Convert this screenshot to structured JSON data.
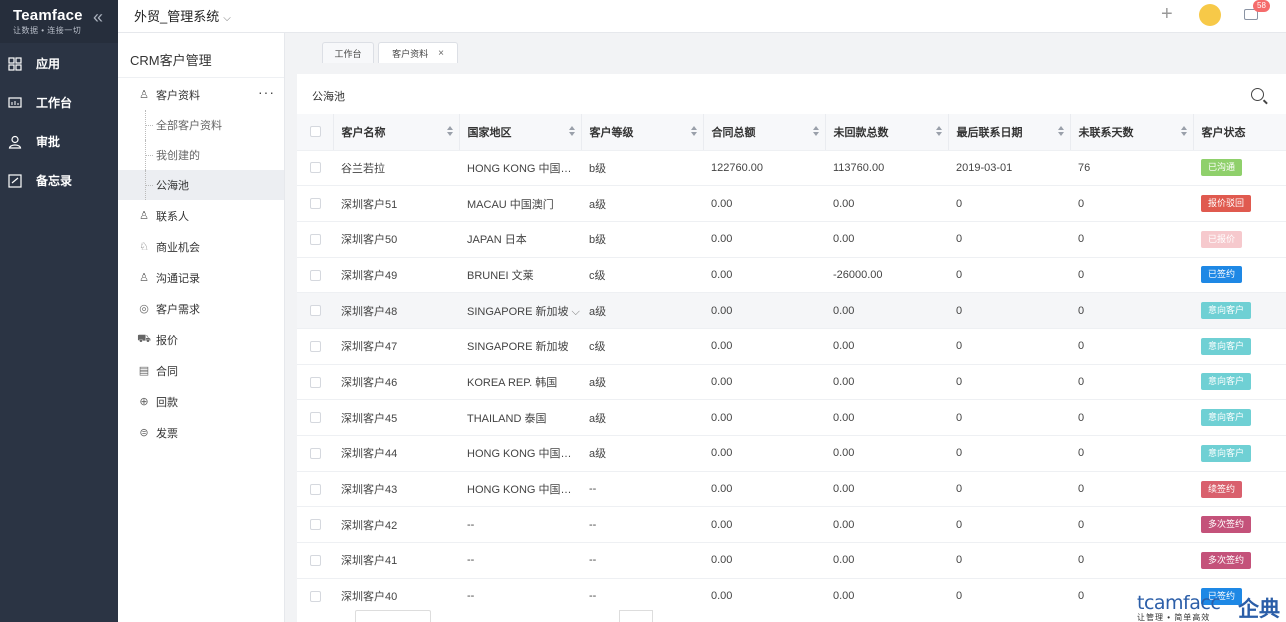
{
  "brand": {
    "name": "Teamface",
    "tagline": "让数据 • 连接一切"
  },
  "rail": [
    {
      "label": "应用",
      "icon": "grid-icon"
    },
    {
      "label": "工作台",
      "icon": "dashboard-icon"
    },
    {
      "label": "审批",
      "icon": "user-check-icon"
    },
    {
      "label": "备忘录",
      "icon": "memo-icon"
    }
  ],
  "topbar": {
    "system_title": "外贸_管理系统",
    "mail_badge": "58"
  },
  "subnav": {
    "title": "CRM客户管理",
    "customer_group": "客户资料",
    "customer_sub": [
      "全部客户资料",
      "我创建的",
      "公海池"
    ],
    "groups": [
      "联系人",
      "商业机会",
      "沟通记录",
      "客户需求",
      "报价",
      "合同",
      "回款",
      "发票"
    ]
  },
  "tabs": {
    "workbench": "工作台",
    "customer": "客户资料",
    "close": "×"
  },
  "panel": {
    "title": "公海池"
  },
  "table": {
    "headers": [
      "客户名称",
      "国家地区",
      "客户等级",
      "合同总额",
      "未回款总数",
      "最后联系日期",
      "未联系天数",
      "客户状态"
    ],
    "rows": [
      {
        "name": "谷兰若拉",
        "region": "HONG KONG 中国香港",
        "level": "b级",
        "total": "122760.00",
        "unpaid": "113760.00",
        "last_date": "2019-03-01",
        "days": "76",
        "status": "已沟通",
        "status_color": "#8fd06b"
      },
      {
        "name": "深圳客户51",
        "region": "MACAU 中国澳门",
        "level": "a级",
        "total": "0.00",
        "unpaid": "0.00",
        "last_date": "0",
        "days": "0",
        "status": "报价驳回",
        "status_color": "#e05a4f"
      },
      {
        "name": "深圳客户50",
        "region": "JAPAN 日本",
        "level": "b级",
        "total": "0.00",
        "unpaid": "0.00",
        "last_date": "0",
        "days": "0",
        "status": "已报价",
        "status_color": "#f6c9cd"
      },
      {
        "name": "深圳客户49",
        "region": "BRUNEI 文莱",
        "level": "c级",
        "total": "0.00",
        "unpaid": "-26000.00",
        "last_date": "0",
        "days": "0",
        "status": "已签约",
        "status_color": "#1e88e5"
      },
      {
        "name": "深圳客户48",
        "region": "SINGAPORE 新加坡",
        "level": "a级",
        "total": "0.00",
        "unpaid": "0.00",
        "last_date": "0",
        "days": "0",
        "status": "意向客户",
        "status_color": "#6fd0d4",
        "highlight": true
      },
      {
        "name": "深圳客户47",
        "region": "SINGAPORE 新加坡",
        "level": "c级",
        "total": "0.00",
        "unpaid": "0.00",
        "last_date": "0",
        "days": "0",
        "status": "意向客户",
        "status_color": "#6fd0d4"
      },
      {
        "name": "深圳客户46",
        "region": "KOREA REP. 韩国",
        "level": "a级",
        "total": "0.00",
        "unpaid": "0.00",
        "last_date": "0",
        "days": "0",
        "status": "意向客户",
        "status_color": "#6fd0d4"
      },
      {
        "name": "深圳客户45",
        "region": "THAILAND 泰国",
        "level": "a级",
        "total": "0.00",
        "unpaid": "0.00",
        "last_date": "0",
        "days": "0",
        "status": "意向客户",
        "status_color": "#6fd0d4"
      },
      {
        "name": "深圳客户44",
        "region": "HONG KONG 中国香港",
        "level": "a级",
        "total": "0.00",
        "unpaid": "0.00",
        "last_date": "0",
        "days": "0",
        "status": "意向客户",
        "status_color": "#6fd0d4"
      },
      {
        "name": "深圳客户43",
        "region": "HONG KONG 中国香港",
        "level": "--",
        "total": "0.00",
        "unpaid": "0.00",
        "last_date": "0",
        "days": "0",
        "status": "续签约",
        "status_color": "#d9606d"
      },
      {
        "name": "深圳客户42",
        "region": "--",
        "level": "--",
        "total": "0.00",
        "unpaid": "0.00",
        "last_date": "0",
        "days": "0",
        "status": "多次签约",
        "status_color": "#c4527a"
      },
      {
        "name": "深圳客户41",
        "region": "--",
        "level": "--",
        "total": "0.00",
        "unpaid": "0.00",
        "last_date": "0",
        "days": "0",
        "status": "多次签约",
        "status_color": "#c4527a"
      },
      {
        "name": "深圳客户40",
        "region": "--",
        "level": "--",
        "total": "0.00",
        "unpaid": "0.00",
        "last_date": "0",
        "days": "0",
        "status": "已签约",
        "status_color": "#1e88e5"
      }
    ]
  },
  "watermark": {
    "en": "tcamfacc",
    "cn": "企典",
    "sub": "让管理 • 简单高效"
  }
}
